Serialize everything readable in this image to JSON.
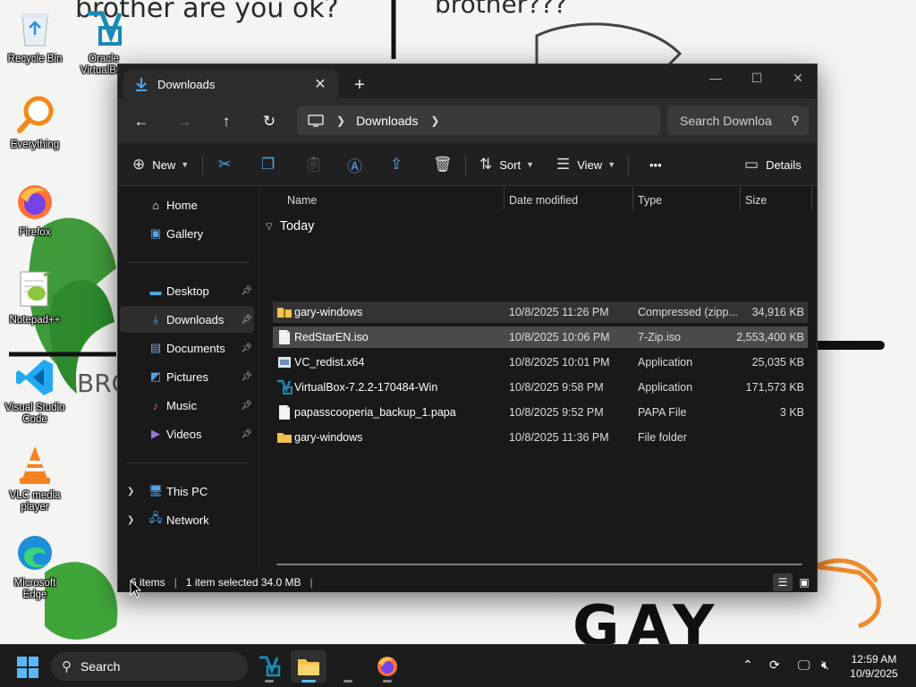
{
  "wallpaper": {
    "text_top_left": "brother are you ok?",
    "text_top_right": "brother???",
    "text_mid_left": "BRO",
    "text_bottom": "GAY"
  },
  "desktop_icons": [
    {
      "label": "Recycle Bin",
      "icon": "recycle-bin-icon"
    },
    {
      "label": "Oracle VirtualBox",
      "icon": "virtualbox-icon"
    },
    {
      "label": "Everything",
      "icon": "everything-search-icon"
    },
    {
      "label": "Firefox",
      "icon": "firefox-icon"
    },
    {
      "label": "Notepad++",
      "icon": "notepadplusplus-icon"
    },
    {
      "label": "Visual Studio Code",
      "icon": "vscode-icon"
    },
    {
      "label": "VLC media player",
      "icon": "vlc-icon"
    },
    {
      "label": "Microsoft Edge",
      "icon": "edge-icon"
    }
  ],
  "explorer": {
    "tab_title": "Downloads",
    "address_crumb": "Downloads",
    "search_placeholder": "Search Downloa",
    "commands": {
      "new": "New",
      "sort": "Sort",
      "view": "View",
      "details": "Details",
      "more": "•••"
    },
    "sidebar": {
      "home": "Home",
      "gallery": "Gallery",
      "desktop": "Desktop",
      "downloads": "Downloads",
      "documents": "Documents",
      "pictures": "Pictures",
      "music": "Music",
      "videos": "Videos",
      "this_pc": "This PC",
      "network": "Network"
    },
    "columns": {
      "name": "Name",
      "date": "Date modified",
      "type": "Type",
      "size": "Size"
    },
    "group_label": "Today",
    "files": [
      {
        "name": "gary-windows",
        "date": "10/8/2025 11:26 PM",
        "type": "Compressed (zipp...",
        "size": "34,916 KB",
        "icon": "zip-folder-icon"
      },
      {
        "name": "RedStarEN.iso",
        "date": "10/8/2025 10:06 PM",
        "type": "7-Zip.iso",
        "size": "2,553,400 KB",
        "icon": "iso-file-icon"
      },
      {
        "name": "VC_redist.x64",
        "date": "10/8/2025 10:01 PM",
        "type": "Application",
        "size": "25,035 KB",
        "icon": "installer-icon"
      },
      {
        "name": "VirtualBox-7.2.2-170484-Win",
        "date": "10/8/2025 9:58 PM",
        "type": "Application",
        "size": "171,573 KB",
        "icon": "virtualbox-installer-icon"
      },
      {
        "name": "papasscooperia_backup_1.papa",
        "date": "10/8/2025 9:52 PM",
        "type": "PAPA File",
        "size": "3 KB",
        "icon": "generic-file-icon"
      },
      {
        "name": "gary-windows",
        "date": "10/8/2025 11:36 PM",
        "type": "File folder",
        "size": "",
        "icon": "folder-icon"
      }
    ],
    "status": {
      "items": "6 items",
      "selection": "1 item selected  34.0 MB"
    }
  },
  "taskbar": {
    "search_label": "Search",
    "time": "12:59 AM",
    "date": "10/9/2025"
  },
  "colors": {
    "accent": "#4ea6ea",
    "window_bg": "#191919",
    "selected_row": "#4a4a4a",
    "taskbar_bg": "#1c1c1c"
  }
}
